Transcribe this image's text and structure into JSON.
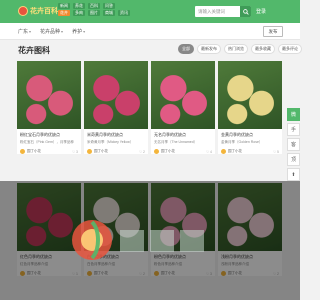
{
  "header": {
    "logo_text": "花卉百科",
    "nav_rows": [
      [
        "新闻",
        "养花",
        "百科",
        "问答"
      ],
      [
        "花卉",
        "多肉",
        "图片",
        "商城",
        "资讯"
      ]
    ],
    "search_placeholder": "请输入关键词",
    "login_label": "登录"
  },
  "breadcrumb": {
    "items": [
      "广东",
      "花卉品种",
      "养护"
    ],
    "publish_label": "发布"
  },
  "section": {
    "title": "花卉图科",
    "filters": [
      "全部",
      "最新发布",
      "热门浏览",
      "最多收藏",
      "最多评论"
    ]
  },
  "cards": [
    {
      "title": "粉红宝石月季的优缺点",
      "desc": "粉红宝石（Pink Gem），月季品种",
      "user": "园丁小花",
      "stat": "3",
      "color": "#d85a7a"
    },
    {
      "title": "米奇黄月季的优缺点",
      "desc": "米奇黄月季（Mickey Yellow）",
      "user": "园丁小花",
      "stat": "2",
      "color": "#c9406a"
    },
    {
      "title": "无名月季的优缺点",
      "desc": "无名月季（The Unnamed）",
      "user": "园丁小花",
      "stat": "4",
      "color": "#e05a84"
    },
    {
      "title": "金黄月季的优缺点",
      "desc": "金黄月季（Golden Rose）",
      "user": "园丁小花",
      "stat": "5",
      "color": "#e6d68a"
    },
    {
      "title": "红色月季的优缺点",
      "desc": "红色月季品种介绍",
      "user": "园丁小花",
      "stat": "1",
      "color": "#c43a5a"
    },
    {
      "title": "白色月季的优缺点",
      "desc": "白色月季品种介绍",
      "user": "园丁小花",
      "stat": "2",
      "color": "#e8e0d8"
    },
    {
      "title": "粉色月季的优缺点",
      "desc": "粉色月季品种介绍",
      "user": "园丁小花",
      "stat": "3",
      "color": "#e8a0b8"
    },
    {
      "title": "浅粉月季的优缺点",
      "desc": "浅粉月季品种介绍",
      "user": "园丁小花",
      "stat": "2",
      "color": "#f0d0d8"
    }
  ],
  "sidebar": {
    "buttons": [
      "微",
      "手",
      "客",
      "顶",
      "⬆"
    ]
  },
  "watermark": {
    "text": "花卉百科"
  }
}
